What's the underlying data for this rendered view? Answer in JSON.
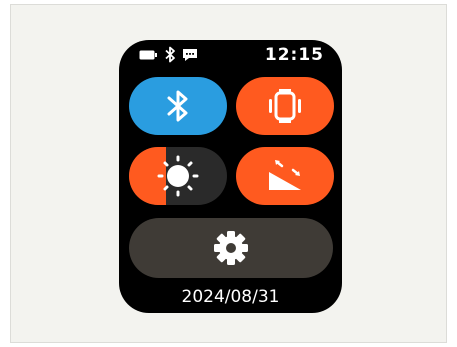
{
  "watch": {
    "time": "12:15",
    "date": "2024/08/31",
    "status_icons": [
      "battery-icon",
      "bluetooth-icon",
      "message-icon"
    ]
  },
  "controls": {
    "bluetooth": {
      "icon": "bluetooth-icon",
      "color": "#2a9de0"
    },
    "vibration": {
      "icon": "vibrate-watch-icon",
      "color": "#ff5a1f"
    },
    "brightness": {
      "icon": "sun-icon",
      "level": 0.38,
      "active_color": "#ff5a1f",
      "track_color": "#2a2a2a"
    },
    "screen_angle": {
      "icon": "tilt-angle-icon",
      "color": "#ff5a1f"
    },
    "settings": {
      "icon": "gear-icon",
      "color": "#3f3b36"
    }
  }
}
